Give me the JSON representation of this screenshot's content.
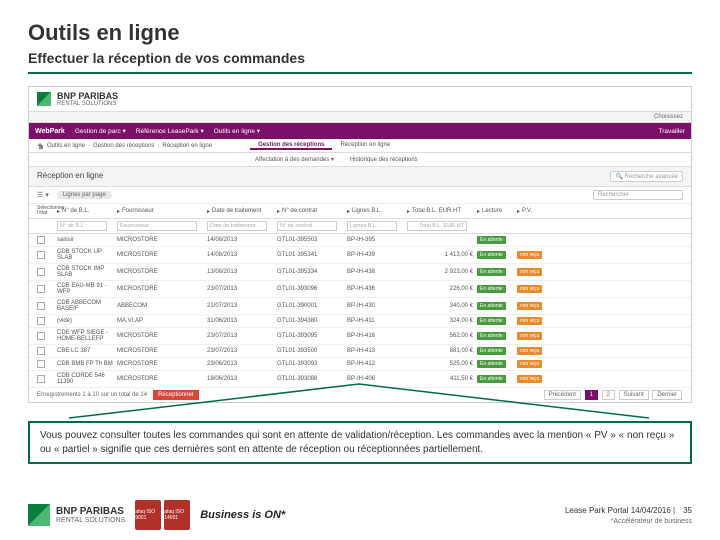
{
  "slide": {
    "title": "Outils en ligne",
    "subtitle": "Effectuer la réception de vos commandes",
    "caption": "Vous pouvez consulter toutes les commandes qui sont en attente de validation/réception. Les commandes avec la mention « PV » « non reçu » ou « partiel » signifie que ces dernières sont en attente de réception ou réceptionnées partiellement."
  },
  "app": {
    "brand_top": "BNP PARIBAS",
    "brand_sub": "RENTAL SOLUTIONS",
    "userbar": {
      "user": "Choisissez",
      "logout": ""
    },
    "menu": {
      "brand": "WebPark",
      "items": [
        "Gestion de parc ▾",
        "Référence LeasePark ▾",
        "Outils en ligne ▾"
      ],
      "right": "Travailler"
    },
    "crumbs": [
      "Outils en ligne",
      "Gestion des réceptions",
      "Réception en ligne"
    ],
    "tabs1": {
      "a": "Gestion des réceptions",
      "b": "Réception en ligne"
    },
    "tabs2": {
      "a": "Affectation à des demandes ▾",
      "b": "Historique des réceptions"
    },
    "panel_title": "Réception en ligne",
    "adv_search": "Recherche avancée",
    "filter_pill": "Lignes par page",
    "filter_all": "☰ ▾",
    "search_ph": "Rechercher",
    "select_label": "Sélectionner\nl'état",
    "cols": {
      "bl": "N° de B.L.",
      "four": "Fournisseur",
      "date": "Date de traitement",
      "contrat": "N° de contrat",
      "lignes": "Lignes B.L.",
      "total": "Total B.L. EUR HT",
      "lect": "Lecture",
      "pv": "P.V."
    },
    "placeholders": {
      "bl": "N° de B.L",
      "four": "Fournisseur",
      "date": "Date de traitement",
      "contrat": "N° de contrat",
      "lignes": "Lignes B.L.",
      "total": "Total B.L. EUR HT"
    },
    "rows": [
      {
        "bl": "saissir",
        "four": "MICROSTORE",
        "date": "14/08/2013",
        "contrat": "GTL01-395503",
        "lignes": "BP-IH-395",
        "total": "",
        "lect": "En attente",
        "pv": ""
      },
      {
        "bl": "CDB STOCK UP SLAB",
        "four": "MICROSTORE",
        "date": "14/08/2013",
        "contrat": "GTL01-395341",
        "lignes": "BP-IH-439",
        "total": "1 413,00 €",
        "lect": "En attente",
        "pv": "non reçu"
      },
      {
        "bl": "CDB STOCK IMP SLAB",
        "four": "MICROSTORE",
        "date": "13/08/2013",
        "contrat": "GTL01-395334",
        "lignes": "BP-IH-438",
        "total": "2 923,00 €",
        "lect": "En attente",
        "pv": "non reçu"
      },
      {
        "bl": "CDB EAU-MB 91 - WFP",
        "four": "MICROSTORE",
        "date": "23/07/2013",
        "contrat": "GTL01-393096",
        "lignes": "BP-IH-436",
        "total": "226,00 €",
        "lect": "En attente",
        "pv": "non reçu"
      },
      {
        "bl": "CDB ABBECOM BASE/F",
        "four": "ABBECOM",
        "date": "21/07/2013",
        "contrat": "GTL01-390001",
        "lignes": "BP-IH-430",
        "total": "340,00 €",
        "lect": "En attente",
        "pv": "non reçu"
      },
      {
        "bl": "(vide)",
        "four": "MA.VI.AP",
        "date": "31/06/2013",
        "contrat": "GTL01-394380",
        "lignes": "BP-IH-411",
        "total": "324,00 €",
        "lect": "En attente",
        "pv": "non reçu"
      },
      {
        "bl": "CDE WFP SIEGE -\nHOME-BELLEFP",
        "four": "MICROSTORE",
        "date": "23/07/2013",
        "contrat": "GTL01-393095",
        "lignes": "BP-IH-416",
        "total": "562,00 €",
        "lect": "En attente",
        "pv": "non reçu"
      },
      {
        "bl": "CBE LC 387",
        "four": "MICROSTORE",
        "date": "23/07/2013",
        "contrat": "GTL01-393500",
        "lignes": "BP-IH-413",
        "total": "881,00 €",
        "lect": "En attente",
        "pv": "non reçu"
      },
      {
        "bl": "CDB BMB FP Th BM",
        "four": "MICROSTORE",
        "date": "23/06/2013",
        "contrat": "GTL01-393093",
        "lignes": "BP-IH-412",
        "total": "525,00 €",
        "lect": "En attente",
        "pv": "non reçu"
      },
      {
        "bl": "CDB CORDE 546 11390",
        "four": "MICROSTORE",
        "date": "18/06/2013",
        "contrat": "GTL01-393088",
        "lignes": "BP-IH-406",
        "total": "411,50 €",
        "lect": "En attente",
        "pv": "non reçu"
      }
    ],
    "pager": {
      "info": "Enregistrements 1 à 10 sur un total de 14",
      "btn": "Réceptionner",
      "prev": "Précédent",
      "p1": "1",
      "p2": "2",
      "next": "Suivant",
      "last": "Dernier"
    }
  },
  "footer": {
    "brand_top": "BNP PARIBAS",
    "brand_sub": "RENTAL SOLUTIONS",
    "afaq1": "afaq\nISO 9001",
    "afaq2": "afaq\nISO 14001",
    "tagline": "Business is ON*",
    "meta": "Lease Park Portal 14/04/2016 |",
    "page": "35",
    "slogan": "*Accélérateur de business"
  }
}
